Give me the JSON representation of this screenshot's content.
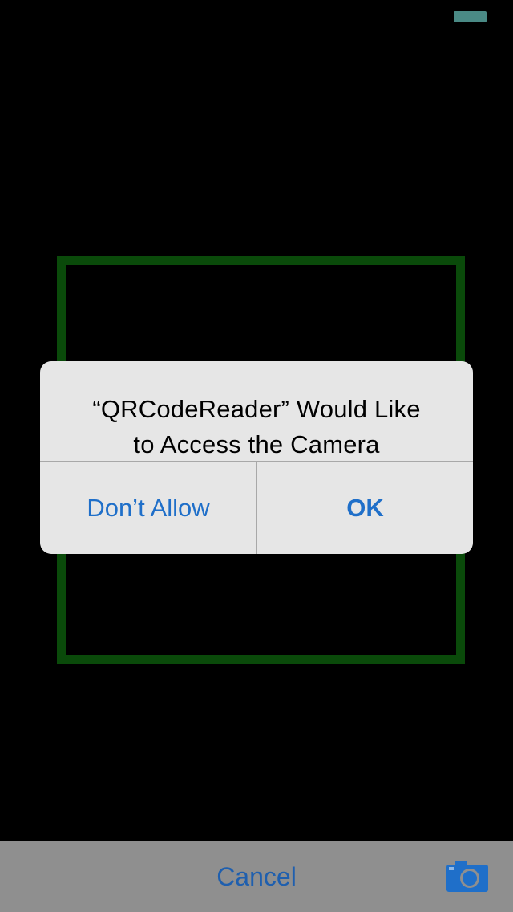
{
  "alert": {
    "title_line1": "“QRCodeReader” Would Like",
    "title_line2": "to Access the Camera",
    "deny_label": "Don’t Allow",
    "ok_label": "OK"
  },
  "toolbar": {
    "cancel_label": "Cancel",
    "camera_icon": "camera-icon"
  },
  "colors": {
    "accent": "#1f6fc9",
    "frame": "#0a4a0a",
    "toolbar": "#8f8f8f"
  }
}
